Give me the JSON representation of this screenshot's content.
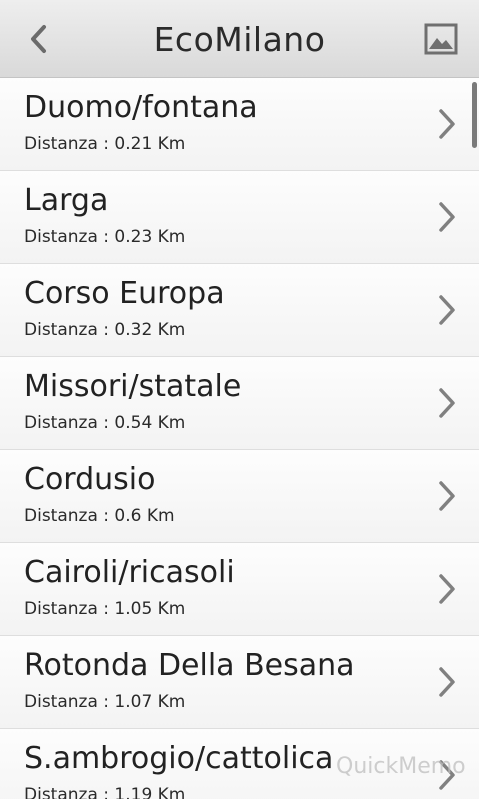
{
  "header": {
    "back_icon": "chevron-left-icon",
    "title": "EcoMilano",
    "gallery_icon": "image-icon"
  },
  "stations": [
    {
      "name": "Duomo/fontana",
      "distance": "Distanza : 0.21 Km"
    },
    {
      "name": "Larga",
      "distance": "Distanza : 0.23 Km"
    },
    {
      "name": "Corso Europa",
      "distance": "Distanza : 0.32 Km"
    },
    {
      "name": "Missori/statale",
      "distance": "Distanza : 0.54 Km"
    },
    {
      "name": "Cordusio",
      "distance": "Distanza : 0.6 Km"
    },
    {
      "name": "Cairoli/ricasoli",
      "distance": "Distanza : 1.05 Km"
    },
    {
      "name": "Rotonda Della Besana",
      "distance": "Distanza : 1.07 Km"
    },
    {
      "name": "S.ambrogio/cattolica",
      "distance": "Distanza : 1.19 Km"
    }
  ],
  "watermark": "QuickMemo",
  "colors": {
    "header_bg": "#e3e3e3",
    "text": "#222222",
    "chevron": "#808080"
  }
}
